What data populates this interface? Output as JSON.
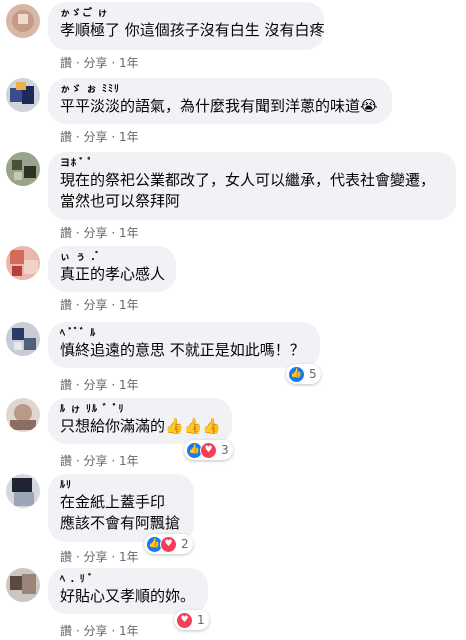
{
  "action_labels": {
    "like": "讚",
    "sep": "·",
    "share": "分享",
    "time": "1年"
  },
  "comments": [
    {
      "author": "ゕゞご ゖ",
      "text": [
        "孝順極了 你這個孩子沒有白生 沒有白疼"
      ],
      "reactions": null
    },
    {
      "author": "ゕゞ ぉ ﾐﾐﾘ",
      "text": [
        "平平淡淡的語氣，為什麼我有聞到洋蔥的味道😭"
      ],
      "reactions": null
    },
    {
      "author": "ヨﾎ  ﾞ ﾟ",
      "text": [
        "現在的祭祀公業都改了，女人可以繼承，代表社會變遷，",
        "當然也可以祭拜阿"
      ],
      "reactions": null
    },
    {
      "author": "ぃ ぅ .  ゙",
      "text": [
        "真正的孝心感人"
      ],
      "reactions": null
    },
    {
      "author": "ﾍ  ﾞ ゙ ﾞ ﾙ",
      "text": [
        "慎終追遠的意思 不就正是如此嗎！？"
      ],
      "reactions": {
        "icons": [
          "like"
        ],
        "count": "5"
      }
    },
    {
      "author": "ﾙ ゖ ﾘﾙ ゛ﾞﾘ",
      "text": [
        "只想給你滿滿的👍👍👍"
      ],
      "reactions": {
        "icons": [
          "like",
          "love"
        ],
        "count": "3"
      }
    },
    {
      "author": "ﾙﾘ",
      "text": [
        "在金紙上蓋手印",
        "應該不會有阿飄搶"
      ],
      "reactions": {
        "icons": [
          "like",
          "love"
        ],
        "count": "2"
      }
    },
    {
      "author": "ﾍ . ﾘ ﾞ",
      "text": [
        "好貼心又孝順的妳。"
      ],
      "reactions": {
        "icons": [
          "love"
        ],
        "count": "1"
      }
    }
  ],
  "colors": {
    "bubble": "#f0f2f5",
    "meta": "#65676b",
    "like": "#1877f2",
    "love": "#f33e58"
  }
}
